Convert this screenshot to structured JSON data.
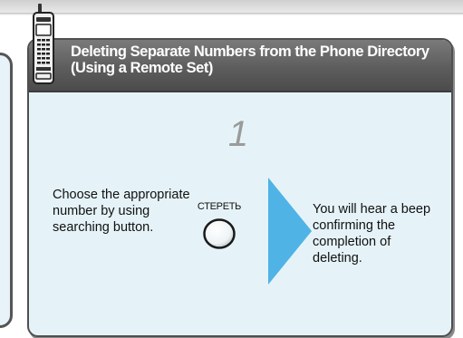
{
  "card": {
    "title_line1": "Deleting Separate Numbers from the Phone Directory",
    "title_line2": "(Using a Remote Set)"
  },
  "step": {
    "number": "1",
    "instruction": "Choose the appropriate number by using searching button.",
    "button_label": "СТЕРЕТЬ",
    "result": "You will hear a beep confirming the completion of deleting."
  },
  "colors": {
    "header": "#5c5c5c",
    "card_background": "#e5f3f8",
    "arrow": "#4fb3e6"
  },
  "icons": [
    "cordless-phone-icon",
    "arrow-right-icon"
  ]
}
